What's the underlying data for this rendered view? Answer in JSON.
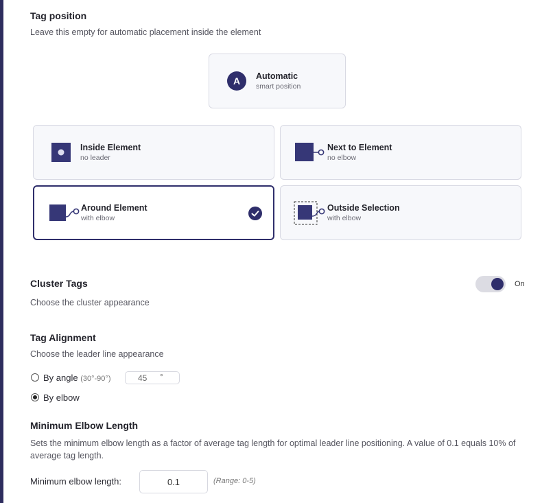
{
  "tag_position": {
    "title": "Tag position",
    "description": "Leave this empty for automatic placement inside the element",
    "automatic": {
      "badge": "A",
      "title": "Automatic",
      "subtitle": "smart position"
    },
    "options": [
      {
        "title": "Inside Element",
        "subtitle": "no leader",
        "selected": false
      },
      {
        "title": "Next to Element",
        "subtitle": "no elbow",
        "selected": false
      },
      {
        "title": "Around Element",
        "subtitle": "with elbow",
        "selected": true
      },
      {
        "title": "Outside Selection",
        "subtitle": "with elbow",
        "selected": false
      }
    ]
  },
  "cluster_tags": {
    "title": "Cluster Tags",
    "description": "Choose the cluster appearance",
    "toggle_state": "On"
  },
  "tag_alignment": {
    "title": "Tag Alignment",
    "description": "Choose the leader line appearance",
    "by_angle_label": "By angle",
    "by_angle_range": "(30°-90°)",
    "angle_value": "45",
    "angle_unit": "°",
    "by_elbow_label": "By elbow",
    "selected": "By elbow"
  },
  "min_elbow": {
    "title": "Minimum Elbow Length",
    "description": "Sets the minimum elbow length as a factor of average tag length for optimal leader line positioning. A value of 0.1 equals 10% of average tag length.",
    "label": "Minimum elbow length:",
    "value": "0.1",
    "range": "(Range: 0-5)"
  },
  "colors": {
    "accent": "#2f2e6b",
    "sidebar": "#2e2d5e"
  }
}
